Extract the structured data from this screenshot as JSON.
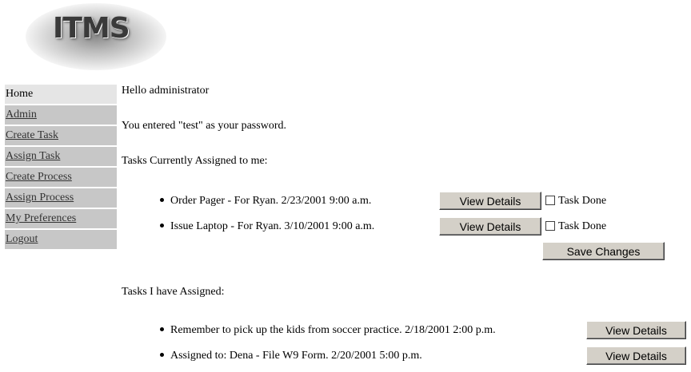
{
  "logo": {
    "text": "ITMS"
  },
  "sidebar": {
    "items": [
      {
        "label": "Home"
      },
      {
        "label": "Admin"
      },
      {
        "label": "Create Task"
      },
      {
        "label": "Assign Task"
      },
      {
        "label": "Create Process"
      },
      {
        "label": "Assign Process"
      },
      {
        "label": "My Preferences"
      },
      {
        "label": "Logout"
      }
    ]
  },
  "main": {
    "greeting": "Hello administrator",
    "password_message": "You entered \"test\" as your password.",
    "assigned_to_me": {
      "heading": "Tasks Currently Assigned to me:",
      "tasks": [
        {
          "text": "Order Pager - For Ryan. 2/23/2001 9:00 a.m.",
          "details_label": "View Details",
          "done_label": "Task Done",
          "done": false
        },
        {
          "text": "Issue Laptop - For Ryan. 3/10/2001 9:00 a.m.",
          "details_label": "View Details",
          "done_label": "Task Done",
          "done": false
        }
      ],
      "save_label": "Save Changes"
    },
    "i_have_assigned": {
      "heading": "Tasks I have Assigned:",
      "tasks": [
        {
          "text": "Remember to pick up the kids from soccer practice. 2/18/2001 2:00 p.m.",
          "details_label": "View Details"
        },
        {
          "text": "Assigned to: Dena - File W9 Form. 2/20/2001 5:00 p.m.",
          "details_label": "View Details"
        }
      ]
    }
  }
}
